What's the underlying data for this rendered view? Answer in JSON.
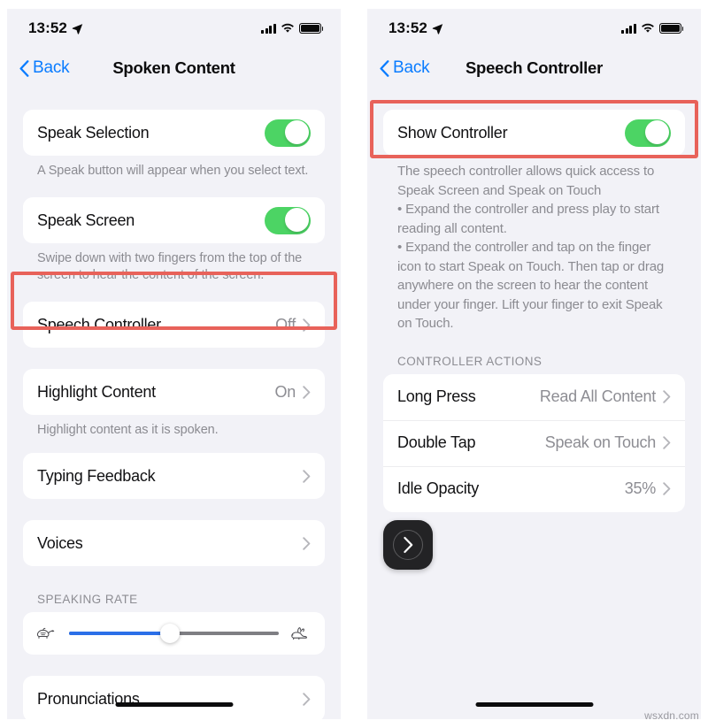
{
  "watermark": "wsxdn.com",
  "colors": {
    "toggle_on": "#4cd464",
    "accent_blue": "#0a7cff",
    "slider_fill": "#2b6fe8",
    "highlight_red": "#e8625a",
    "panel_bg": "#f2f2f7",
    "card_bg": "#ffffff"
  },
  "status_bar": {
    "time": "13:52",
    "location_icon": "location-arrow-icon",
    "signal_icon": "cellular-signal-icon",
    "wifi_icon": "wifi-icon",
    "battery_icon": "battery-full-icon"
  },
  "left_panel": {
    "nav": {
      "back_label": "Back",
      "title": "Spoken Content"
    },
    "rows": {
      "speak_selection": {
        "label": "Speak Selection",
        "toggle_state": "on",
        "footnote": "A Speak button will appear when you select text."
      },
      "speak_screen": {
        "label": "Speak Screen",
        "toggle_state": "on",
        "footnote": "Swipe down with two fingers from the top of the screen to hear the content of the screen."
      },
      "speech_controller": {
        "label": "Speech Controller",
        "value": "Off"
      },
      "highlight_content": {
        "label": "Highlight Content",
        "value": "On",
        "footnote": "Highlight content as it is spoken."
      },
      "typing_feedback": {
        "label": "Typing Feedback"
      },
      "voices": {
        "label": "Voices"
      },
      "pronunciations": {
        "label": "Pronunciations"
      }
    },
    "speaking_rate": {
      "section_header": "SPEAKING RATE",
      "slow_icon": "tortoise-icon",
      "fast_icon": "rabbit-icon",
      "value_percent": 48
    }
  },
  "right_panel": {
    "nav": {
      "back_label": "Back",
      "title": "Speech Controller"
    },
    "show_controller": {
      "label": "Show Controller",
      "toggle_state": "on"
    },
    "description": "The speech controller allows quick access to Speak Screen and Speak on Touch\n • Expand the controller and press play to start reading all content.\n • Expand the controller and tap on the finger icon to start Speak on Touch. Then tap or drag anywhere on the screen to hear the content under your finger. Lift your finger to exit Speak on Touch.",
    "controller_actions": {
      "section_header": "CONTROLLER ACTIONS",
      "items": [
        {
          "label": "Long Press",
          "value": "Read All Content"
        },
        {
          "label": "Double Tap",
          "value": "Speak on Touch"
        },
        {
          "label": "Idle Opacity",
          "value": "35%"
        }
      ]
    },
    "floating_controller": {
      "icon": "chevron-right-icon"
    }
  }
}
